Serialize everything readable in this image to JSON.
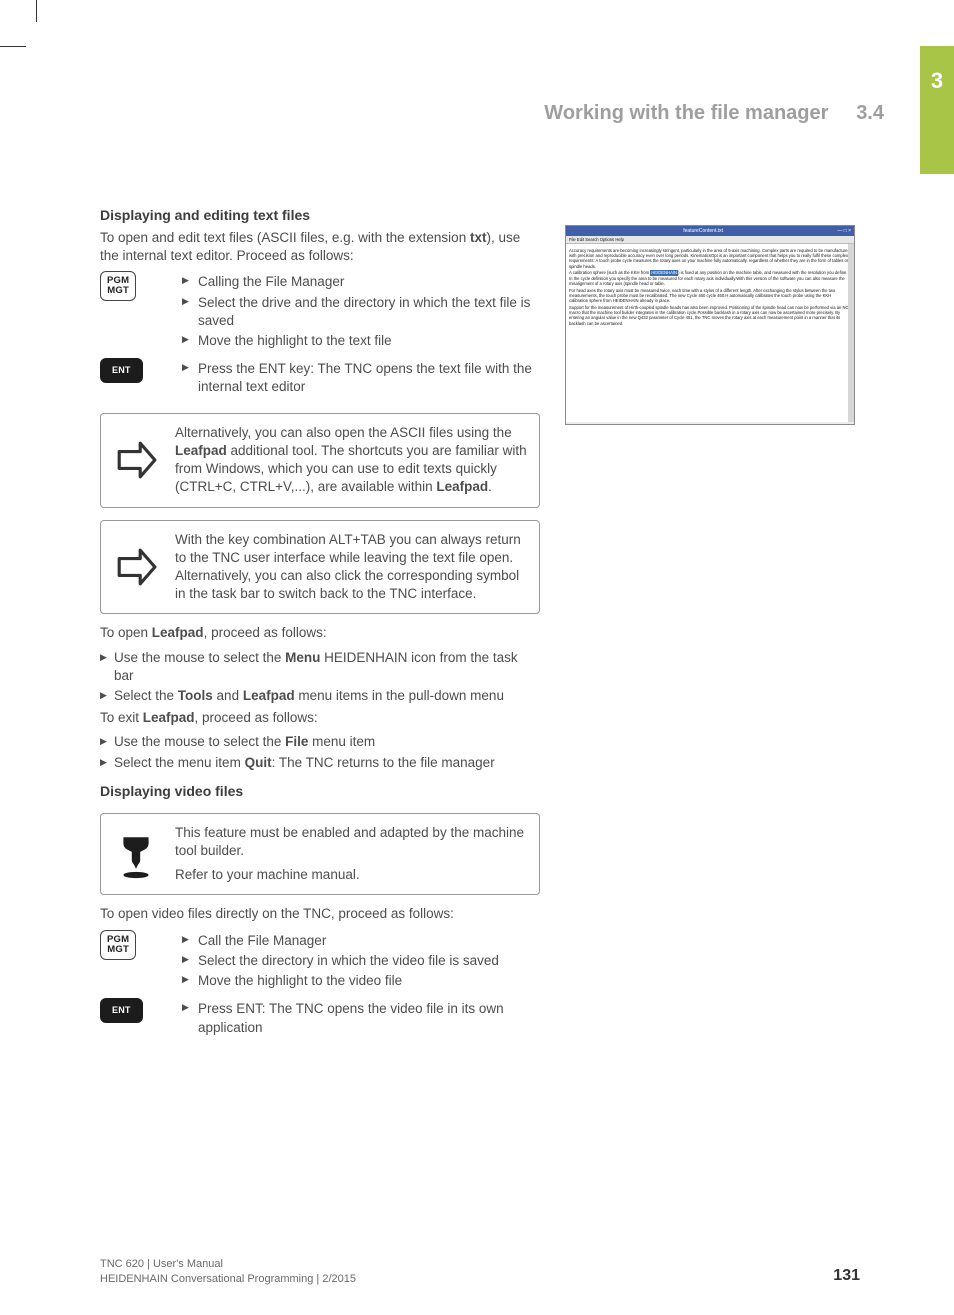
{
  "chapter_tab": "3",
  "header": {
    "title": "Working with the file manager",
    "section": "3.4"
  },
  "text": {
    "h_displaying_text": "Displaying and editing text files",
    "intro_text_a": "To open and edit text files (ASCII files, e.g. with the extension ",
    "intro_text_bold": "txt",
    "intro_text_b": "), use the internal text editor. Proceed as follows:",
    "step1": "Calling the File Manager",
    "step2": "Select the drive and the directory in which the text file is saved",
    "step3": "Move the highlight to the text file",
    "step4": "Press the ENT key: The TNC opens the text file with the internal text editor",
    "note1_a": "Alternatively, you can also open the ASCII files using the ",
    "note1_bold1": "Leafpad",
    "note1_b": " additional tool. The shortcuts you are familiar with from Windows, which you can use to edit texts quickly (CTRL+C, CTRL+V,...), are available within ",
    "note1_bold2": "Leafpad",
    "note1_c": ".",
    "note2": "With the key combination ALT+TAB you can always return to the TNC user interface while leaving the text file open. Alternatively, you can also click the corresponding symbol in the task bar to switch back to the TNC interface.",
    "open_leafpad_a": "To open ",
    "open_leafpad_bold": "Leafpad",
    "open_leafpad_b": ", proceed as follows:",
    "open_lp_step1_a": "Use the mouse to select the ",
    "open_lp_step1_bold": "Menu",
    "open_lp_step1_b": " HEIDENHAIN icon from the task bar",
    "open_lp_step2_a": "Select the ",
    "open_lp_step2_bold1": "Tools",
    "open_lp_step2_mid": " and ",
    "open_lp_step2_bold2": "Leafpad",
    "open_lp_step2_b": " menu items in the pull-down menu",
    "exit_leafpad_a": "To exit ",
    "exit_leafpad_bold": "Leafpad",
    "exit_leafpad_b": ", proceed as follows:",
    "exit_lp_step1_a": "Use the mouse to select the ",
    "exit_lp_step1_bold": "File",
    "exit_lp_step1_b": " menu item",
    "exit_lp_step2_a": "Select the menu item ",
    "exit_lp_step2_bold": "Quit",
    "exit_lp_step2_b": ": The TNC returns to the file manager",
    "h_displaying_video": "Displaying video files",
    "note3_p1": "This feature must be enabled and adapted by the machine tool builder.",
    "note3_p2": "Refer to your machine manual.",
    "video_intro": "To open video files directly on the TNC, proceed as follows:",
    "vstep1": "Call the File Manager",
    "vstep2": "Select the directory in which the video file is saved",
    "vstep3": "Move the highlight to the video file",
    "vstep4": "Press ENT: The TNC opens the video file in its own application"
  },
  "keys": {
    "pgm_mgt_l1": "PGM",
    "pgm_mgt_l2": "MGT",
    "ent": "ENT"
  },
  "screenshot": {
    "title": "featureContent.txt",
    "window_buttons": "— □ ×",
    "menu": "File  Edit  Search  Options  Help",
    "p1": "Accuracy requirements are becoming increasingly stringent, particularly in the area of 5-axis machining. Complex parts are required to be manufactured with precision and reproducible accuracy even over long periods. KinematicsOpt is an important component that helps you to really fulfil these complex requirements: A touch probe cycle measures the rotary axes on your machine fully automatically. regardless of whether they are in the form of tables or spindle heads.",
    "p2_a": "A calibration sphere (such as the KKH from ",
    "p2_hl": "HEIDENHAIN",
    "p2_b": ") is fixed at any position on the machine table, and measured with the resolution you define. In the cycle definition you specify the area to be measured for each rotary axis individually.With this version of the software you can also measure the misalignment of a rotary axis (spindle head or table.",
    "p3": "For head axes the rotary axis must be measured twice, each time with a stylus of a different length. After exchanging the stylus between the two measurements, the touch probe must be recalibrated. The new Cycle 460 cycle 460.H automatically calibrates the touch probe using the KKH calibration sphere from HEIDENHAIN already in place.",
    "p4": "Support for the measurement of Hirth-coupled spindle heads has also been improved. Positioning of the spindle head can now be performed via an NC macro that the machine tool builder integrates in the calibration cycle.Possible backlash in a rotary axis can now be ascertained more precisely. By entering an angular value in the new Q432 parameter of Cycle 451, the TNC moves the rotary axis at each measurement point in a manner that its backlash can be ascertained."
  },
  "footer": {
    "line1": "TNC 620 | User's Manual",
    "line2": "HEIDENHAIN Conversational Programming | 2/2015",
    "page": "131"
  }
}
